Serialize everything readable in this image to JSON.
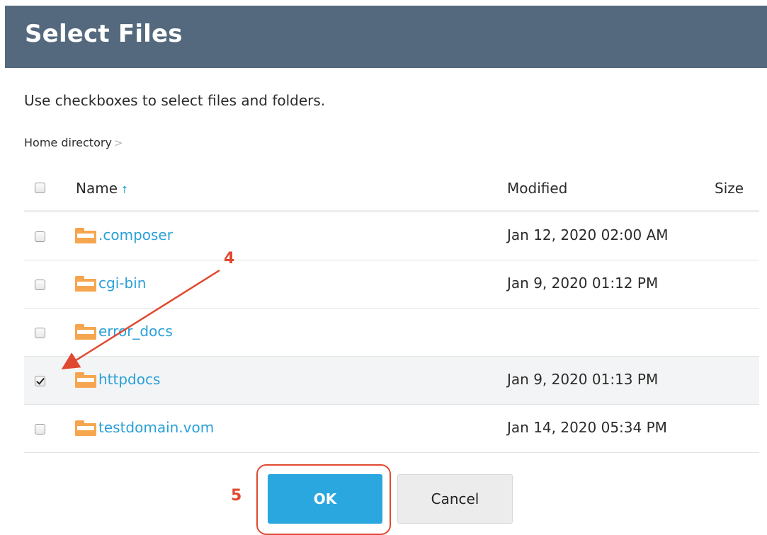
{
  "dialog": {
    "title": "Select Files",
    "intro": "Use checkboxes to select files and folders.",
    "breadcrumb": {
      "label": "Home directory",
      "separator": ">"
    }
  },
  "table": {
    "columns": {
      "name": "Name",
      "sort_indicator": "↑",
      "modified": "Modified",
      "size": "Size"
    },
    "rows": [
      {
        "name": ".composer",
        "modified": "Jan 12, 2020 02:00 AM",
        "checked": false
      },
      {
        "name": "cgi-bin",
        "modified": "Jan 9, 2020 01:12 PM",
        "checked": false
      },
      {
        "name": "error_docs",
        "modified": "",
        "checked": false
      },
      {
        "name": "httpdocs",
        "modified": "Jan 9, 2020 01:13 PM",
        "checked": true
      },
      {
        "name": "testdomain.vom",
        "modified": "Jan 14, 2020 05:34 PM",
        "checked": false
      }
    ]
  },
  "annotations": {
    "step_four": "4",
    "step_five": "5"
  },
  "buttons": {
    "ok": "OK",
    "cancel": "Cancel"
  },
  "colors": {
    "header": "#54697d",
    "link": "#2aa0d8",
    "primary": "#2aa7de",
    "folder": "#f6a64f",
    "annotation": "#e0492f"
  },
  "icons": {
    "folder": "folder-icon",
    "sort": "sort-ascending-icon"
  }
}
